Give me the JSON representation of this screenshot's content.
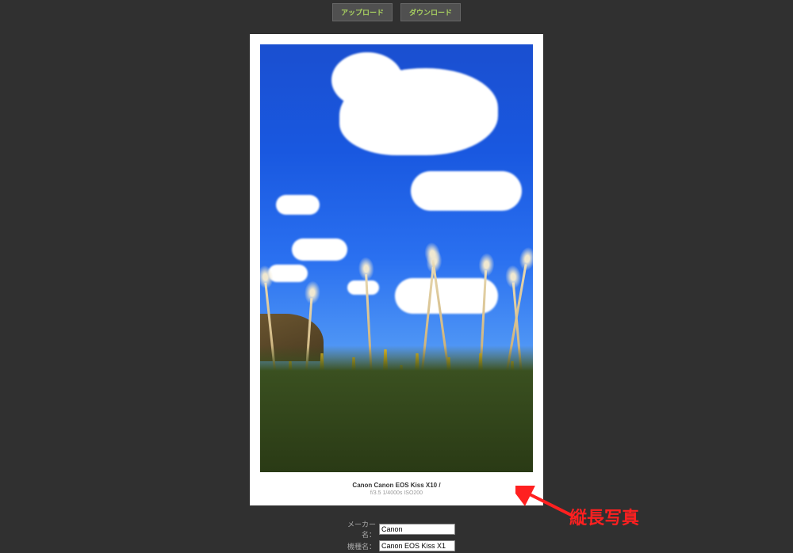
{
  "buttons": {
    "upload": "アップロード",
    "download": "ダウンロード"
  },
  "caption": {
    "line1": "Canon  Canon EOS Kiss X10  /",
    "line2": "f/3.5 1/4000s ISO200"
  },
  "annotation": "縦長写真",
  "form": {
    "maker_label": "メーカー名：",
    "maker_value": "Canon",
    "model_label": "機種名：",
    "model_value": "Canon EOS Kiss X1"
  }
}
